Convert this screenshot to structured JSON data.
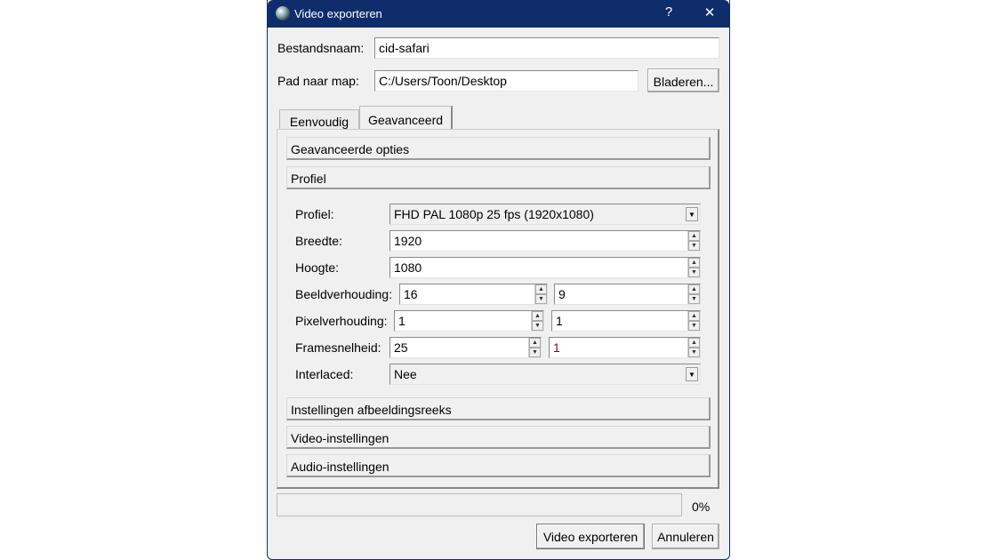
{
  "window": {
    "title": "Video exporteren",
    "help": "?",
    "close": "✕"
  },
  "file": {
    "name_label": "Bestandsnaam:",
    "name_value": "cid-safari",
    "path_label": "Pad naar map:",
    "path_value": "C:/Users/Toon/Desktop",
    "browse": "Bladeren..."
  },
  "tabs": [
    {
      "label": "Eenvoudig"
    },
    {
      "label": "Geavanceerd",
      "active": true
    }
  ],
  "sections": {
    "advanced": "Geavanceerde opties",
    "profile": "Profiel",
    "image_seq": "Instellingen afbeeldingsreeks",
    "video": "Video-instellingen",
    "audio": "Audio-instellingen"
  },
  "profile": {
    "profile_label": "Profiel:",
    "profile_value": "FHD PAL 1080p 25 fps (1920x1080)",
    "width_label": "Breedte:",
    "width_value": "1920",
    "height_label": "Hoogte:",
    "height_value": "1080",
    "aspect_label": "Beeldverhouding:",
    "aspect_num": "16",
    "aspect_den": "9",
    "pixel_label": "Pixelverhouding:",
    "pixel_num": "1",
    "pixel_den": "1",
    "fps_label": "Framesnelheid:",
    "fps_num": "25",
    "fps_den": "1",
    "interlaced_label": "Interlaced:",
    "interlaced_value": "Nee"
  },
  "progress": {
    "value": 0,
    "text": "0%"
  },
  "buttons": {
    "export": "Video exporteren",
    "cancel": "Annuleren"
  }
}
